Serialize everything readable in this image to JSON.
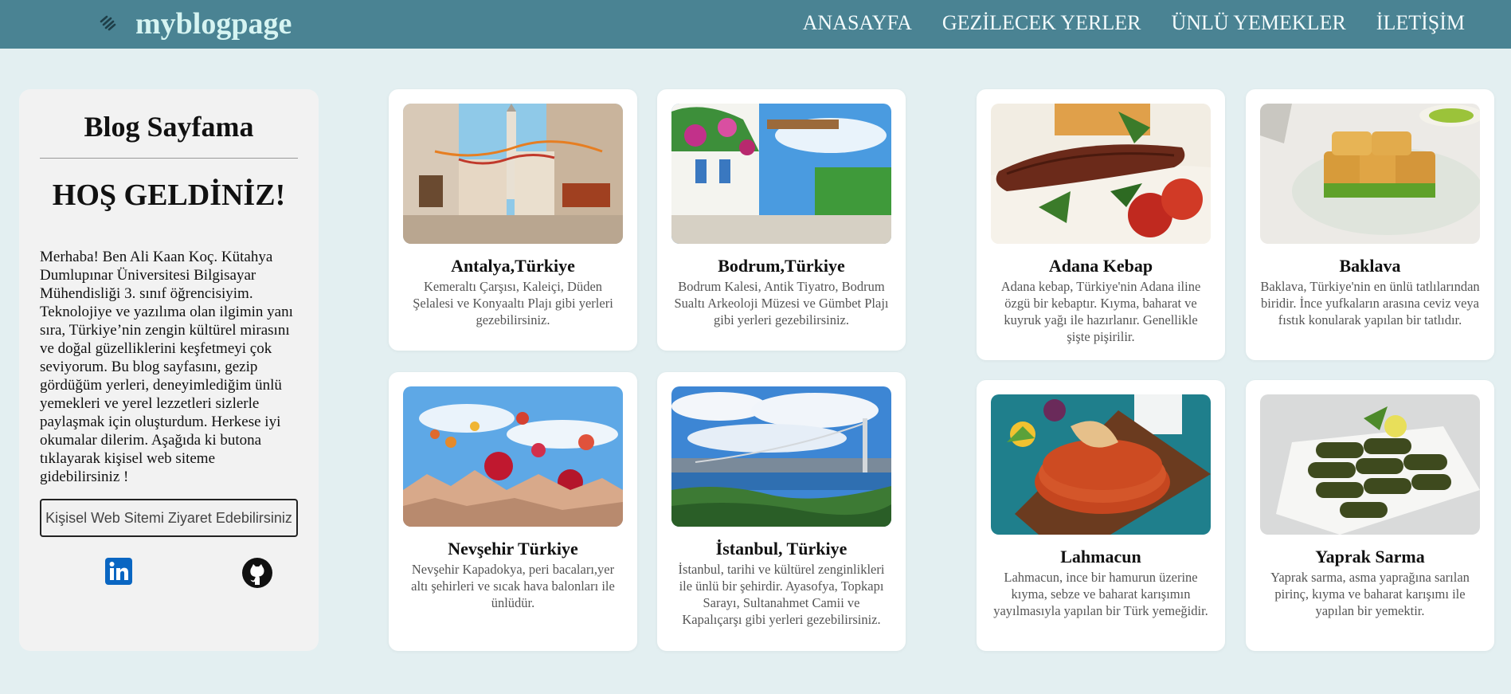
{
  "header": {
    "brand": "myblogpage",
    "nav": [
      "ANASAYFA",
      "GEZİLECEK YERLER",
      "ÜNLÜ YEMEKLER",
      "İLETİŞİM"
    ]
  },
  "sidebar": {
    "title": "Blog Sayfama",
    "welcome": "HOŞ GELDİNİZ!",
    "intro": "Merhaba! Ben Ali Kaan Koç. Kütahya Dumlupınar Üniversitesi Bilgisayar Mühendisliği 3. sınıf öğrencisiyim. Teknolojiye ve yazılıma olan ilgimin yanı sıra, Türkiye’nin zengin kültürel mirasını ve doğal güzelliklerini keşfetmeyi çok seviyorum. Bu blog sayfasını, gezip gördüğüm yerleri, deneyimlediğim ünlü yemekleri ve yerel lezzetleri sizlerle paylaşmak için oluşturdum. Herkese iyi okumalar dilerim. Aşağıda ki butona tıklayarak kişisel web siteme gidebilirsiniz !",
    "button_label": "Kişisel Web Sitemi Ziyaret Edebilirsiniz",
    "linkedin_icon": "linkedin-icon",
    "github_icon": "github-icon"
  },
  "places": [
    {
      "title": "Antalya,Türkiye",
      "desc": "Kemeraltı Çarşısı, Kaleiçi, Düden Şelalesi ve Konyaaltı Plajı gibi yerleri gezebilirsiniz."
    },
    {
      "title": "Bodrum,Türkiye",
      "desc": "Bodrum Kalesi, Antik Tiyatro, Bodrum Sualtı Arkeoloji Müzesi ve Gümbet Plajı gibi yerleri gezebilirsiniz."
    },
    {
      "title": "Nevşehir Türkiye",
      "desc": "Nevşehir Kapadokya, peri bacaları,yer altı şehirleri ve sıcak hava balonları ile ünlüdür."
    },
    {
      "title": "İstanbul, Türkiye",
      "desc": "İstanbul, tarihi ve kültürel zenginlikleri ile ünlü bir şehirdir. Ayasofya, Topkapı Sarayı, Sultanahmet Camii ve Kapalıçarşı gibi yerleri gezebilirsiniz."
    }
  ],
  "foods": [
    {
      "title": "Adana Kebap",
      "desc": "Adana kebap, Türkiye'nin Adana iline özgü bir kebaptır. Kıyma, baharat ve kuyruk yağı ile hazırlanır. Genellikle şişte pişirilir."
    },
    {
      "title": "Baklava",
      "desc": "Baklava, Türkiye'nin en ünlü tatlılarından biridir. İnce yufkaların arasına ceviz veya fıstık konularak yapılan bir tatlıdır."
    },
    {
      "title": "Lahmacun",
      "desc": "Lahmacun, ince bir hamurun üzerine kıyma, sebze ve baharat karışımın yayılmasıyla yapılan bir Türk yemeğidir."
    },
    {
      "title": "Yaprak Sarma",
      "desc": "Yaprak sarma, asma yaprağına sarılan pirinç, kıyma ve baharat karışımı ile yapılan bir yemektir."
    }
  ],
  "colors": {
    "navbar": "#4a8393",
    "brand": "#d6f4f2",
    "page_bg": "#e3eff1",
    "card_bg": "#ffffff",
    "linkedin": "#0a66c2"
  }
}
